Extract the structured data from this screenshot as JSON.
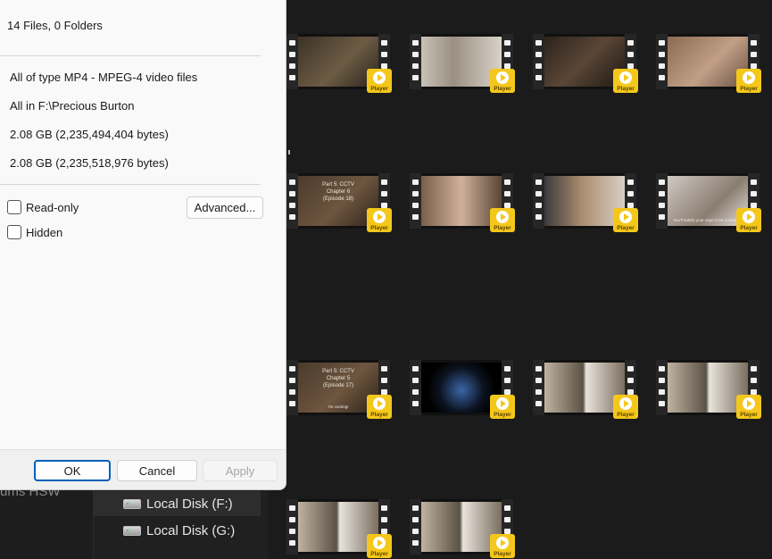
{
  "dialog": {
    "summary": "14 Files, 0 Folders",
    "type_line": "All of type MP4 - MPEG-4 video files",
    "location_line": "All in F:\\Precious Burton",
    "size": "2.08 GB (2,235,494,404 bytes)",
    "size_on_disk": "2.08 GB (2,235,518,976 bytes)",
    "attributes": {
      "readonly_label": "Read-only",
      "readonly_checked": false,
      "hidden_label": "Hidden",
      "hidden_checked": false,
      "advanced_label": "Advanced..."
    },
    "buttons": {
      "ok": "OK",
      "cancel": "Cancel",
      "apply": "Apply"
    }
  },
  "sidebar": {
    "clipped_text": "ums    HSW",
    "drives": [
      {
        "label": "Local Disk (F:)",
        "icon": "drive-icon",
        "selected": true
      },
      {
        "label": "Local Disk (G:)",
        "icon": "drive-icon",
        "selected": false
      }
    ]
  },
  "thumbnails": {
    "badge_label": "Player",
    "badge_color": "#f4c71b",
    "items": [
      {
        "caption": "",
        "subtitle": ""
      },
      {
        "caption": "",
        "subtitle": ""
      },
      {
        "caption": "",
        "subtitle": ""
      },
      {
        "caption": "",
        "subtitle": ""
      },
      {
        "caption": "Part 5: CCTV\nChapter 6\n(Episode 18)",
        "subtitle": ""
      },
      {
        "caption": "",
        "subtitle": ""
      },
      {
        "caption": "",
        "subtitle": ""
      },
      {
        "caption": "",
        "subtitle": "You'll satisfy your urge to be a member"
      },
      {
        "caption": "Part 5: CCTV\nChapter 5\n(Episode 17)",
        "subtitle": "I'm coming!"
      },
      {
        "caption": "",
        "subtitle": ""
      },
      {
        "caption": "",
        "subtitle": ""
      },
      {
        "caption": "",
        "subtitle": ""
      },
      {
        "caption": "",
        "subtitle": ""
      },
      {
        "caption": "",
        "subtitle": ""
      }
    ]
  }
}
